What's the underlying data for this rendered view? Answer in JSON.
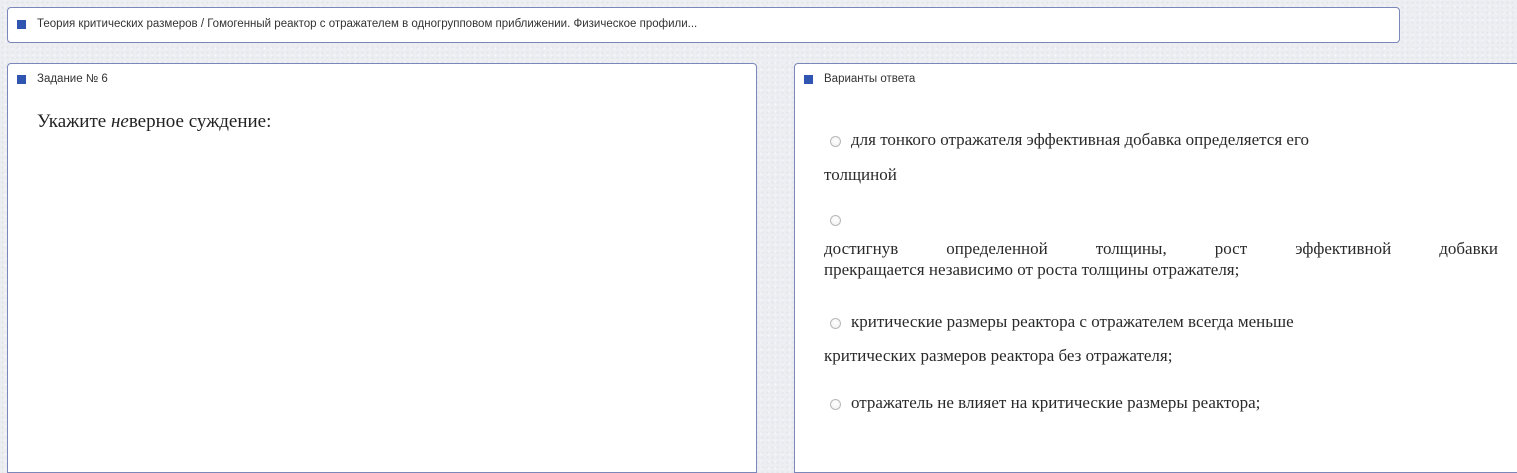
{
  "breadcrumb": {
    "text": "Теория критических размеров / Гомогенный реактор с отражателем в одногрупповом приближении. Физическое профили..."
  },
  "task": {
    "header": "Задание № 6",
    "question_before": "Укажите ",
    "question_italic": "не",
    "question_after": "верное суждение:"
  },
  "answers": {
    "header": "Варианты ответа",
    "options": [
      {
        "line1": "для тонкого отражателя эффективная добавка определяется его",
        "line2": "толщиной"
      },
      {
        "line1_words": [
          "достигнув",
          "определенной",
          "толщины,",
          "рост",
          "эффективной",
          "добавки"
        ],
        "line2": "прекращается независимо от роста толщины отражателя;"
      },
      {
        "line1": "критические размеры реактора с отражателем всегда меньше",
        "line2": "критических размеров реактора без отражателя;"
      },
      {
        "line1": "отражатель не влияет на критические размеры реактора;"
      }
    ]
  },
  "colors": {
    "accent": "#2f55b0",
    "border": "#7a87b8",
    "panel": "#ffffff"
  }
}
